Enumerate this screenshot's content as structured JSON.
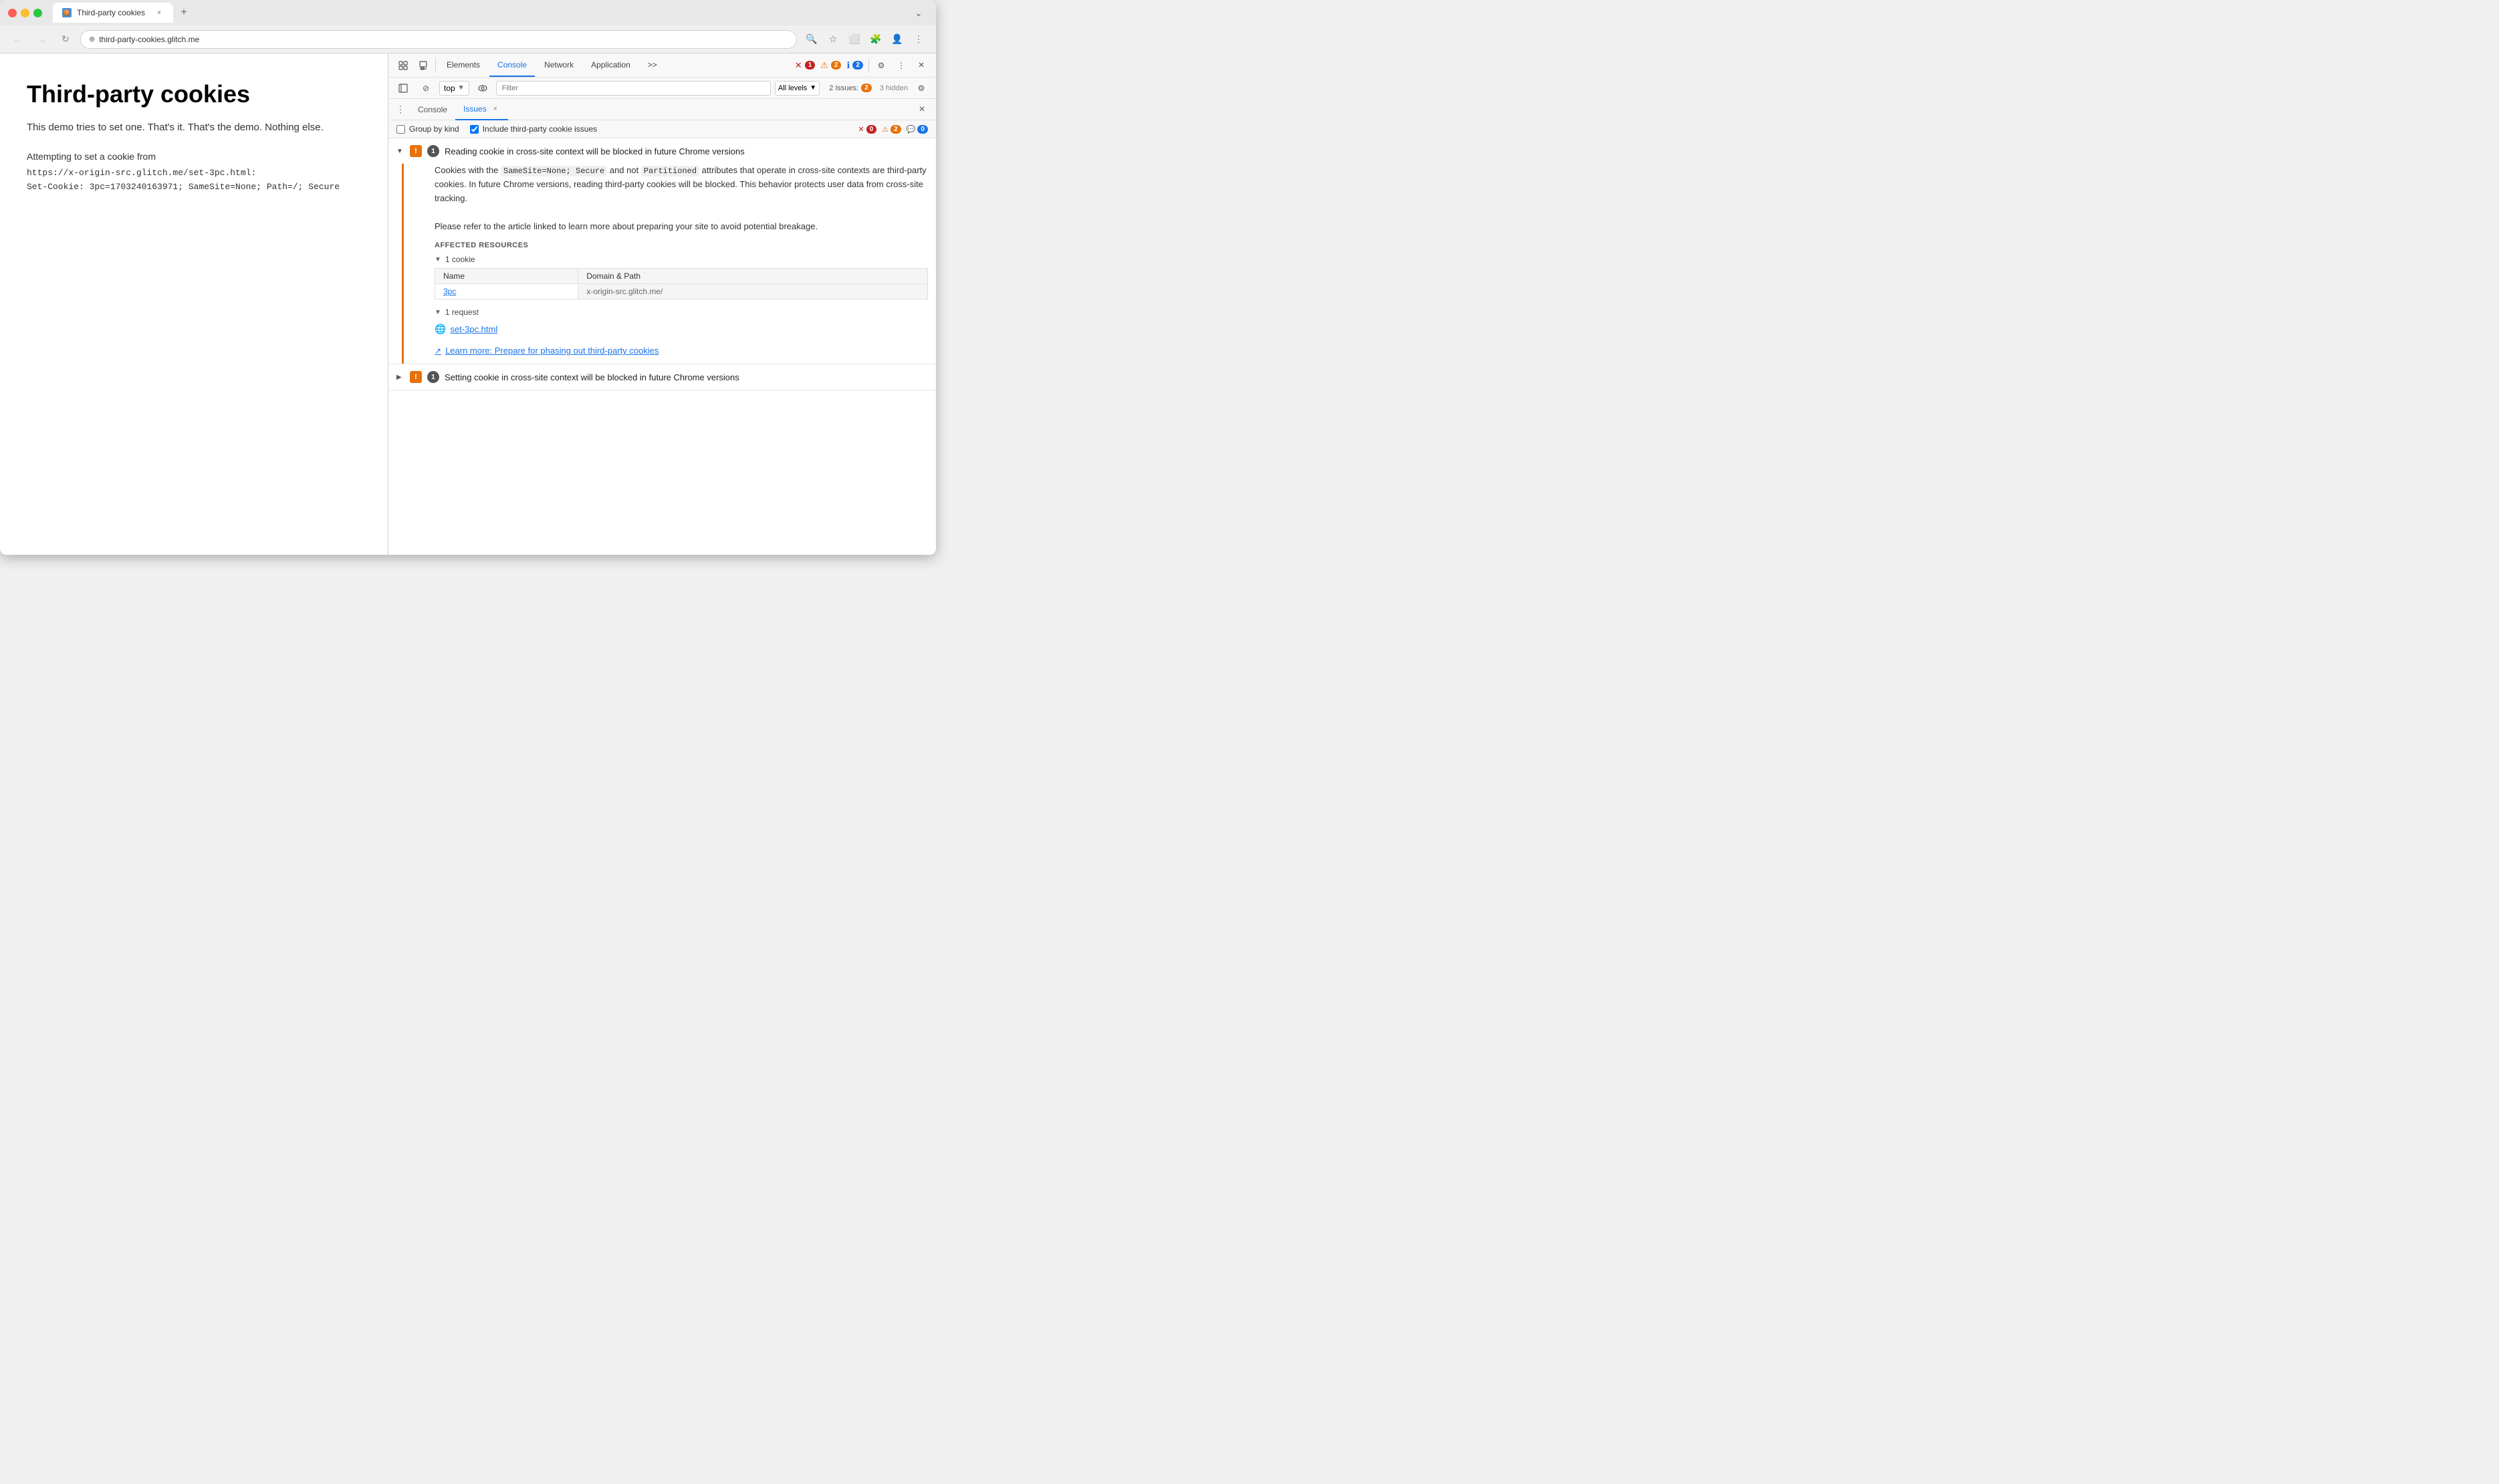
{
  "browser": {
    "tab_title": "Third-party cookies",
    "tab_favicon": "🍪",
    "url": "third-party-cookies.glitch.me",
    "nav": {
      "back_disabled": true,
      "forward_disabled": true
    }
  },
  "page": {
    "title": "Third-party cookies",
    "subtitle": "This demo tries to set one. That's it. That's the demo. Nothing else.",
    "cookie_label": "Attempting to set a cookie from",
    "cookie_url": "https://x-origin-src.glitch.me/set-3pc.html:",
    "cookie_value": "Set-Cookie: 3pc=1703240163971; SameSite=None; Path=/; Secure"
  },
  "devtools": {
    "tabs": {
      "elements": "Elements",
      "console": "Console",
      "network": "Network",
      "application": "Application",
      "more": ">>"
    },
    "error_count": "1",
    "warn_count": "2",
    "info_count": "2",
    "console_bar": {
      "top_label": "top",
      "filter_placeholder": "Filter",
      "level_label": "All levels",
      "issues_label": "2 Issues:",
      "issues_warn": "2",
      "hidden_label": "3 hidden"
    },
    "sub_tabs": {
      "console_label": "Console",
      "issues_label": "Issues",
      "close_label": "×"
    },
    "issues": {
      "group_by_kind": "Group by kind",
      "include_third_party": "Include third-party cookie issues",
      "error_count": "0",
      "warn_count": "2",
      "info_count": "0",
      "issue1": {
        "title": "Reading cookie in cross-site context will be blocked in future Chrome versions",
        "count": "1",
        "expanded": true,
        "description1": "Cookies with the ",
        "code1": "SameSite=None; Secure",
        "description2": " and not ",
        "code2": "Partitioned",
        "description3": " attributes that operate in cross-site contexts are third-party cookies. In future Chrome versions, reading third-party cookies will be blocked. This behavior protects user data from cross-site tracking.",
        "description4": "Please refer to the article linked to learn more about preparing your site to avoid potential breakage.",
        "affected_resources": "AFFECTED RESOURCES",
        "cookie_section": "1 cookie",
        "cookie_col1": "Name",
        "cookie_col2": "Domain & Path",
        "cookie_name": "3pc",
        "cookie_domain": "x-origin-src.glitch.me/",
        "request_section": "1 request",
        "request_url": "set-3pc.html",
        "learn_more": "Learn more: Prepare for phasing out third-party cookies"
      },
      "issue2": {
        "title": "Setting cookie in cross-site context will be blocked in future Chrome versions",
        "count": "1",
        "expanded": false
      }
    }
  },
  "icons": {
    "back": "←",
    "forward": "→",
    "refresh": "↻",
    "secure": "⊕",
    "zoom": "🔍",
    "star": "☆",
    "download": "↓",
    "extensions": "🧩",
    "menu": "⋮",
    "close": "×",
    "expand_down": "▼",
    "expand_right": "▶",
    "warning": "!",
    "error": "✕",
    "info": "ℹ",
    "external_link": "↗",
    "globe": "🌐",
    "settings": "⚙",
    "inspect": "⊞",
    "device": "📱",
    "more_tabs": ">>"
  }
}
